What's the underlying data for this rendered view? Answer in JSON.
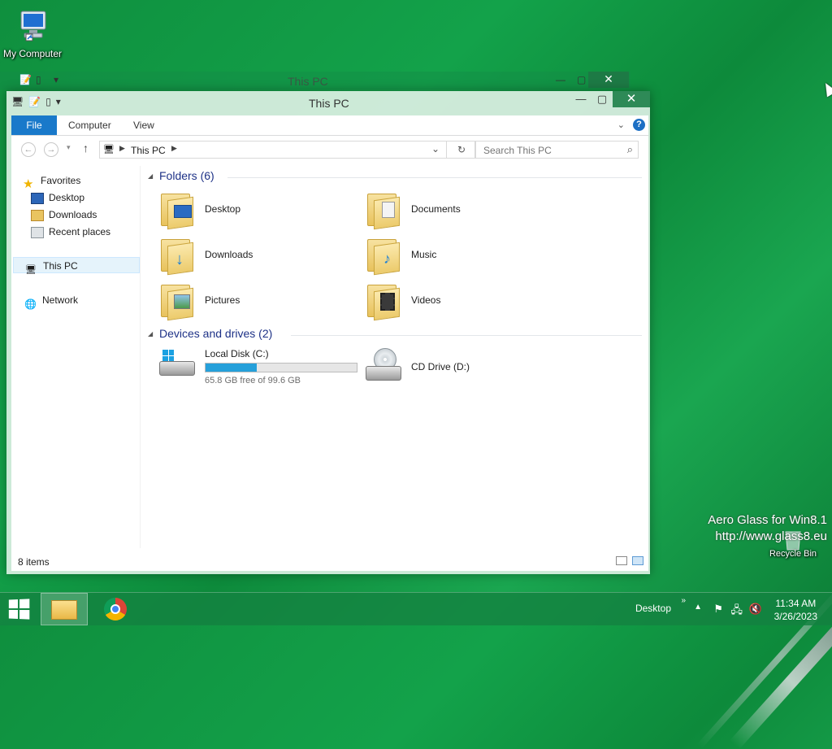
{
  "desktop": {
    "icons": [
      {
        "label": "My Computer",
        "icon": "computer-icon"
      },
      {
        "label": "Recycle Bin",
        "icon": "recycle-bin-icon"
      }
    ],
    "watermark": {
      "line1": "Aero Glass for Win8.1",
      "line2": "http://www.glass8.eu"
    }
  },
  "ghost_window": {
    "title": "This PC"
  },
  "window": {
    "title": "This PC",
    "ribbon": {
      "file": "File",
      "computer": "Computer",
      "view": "View",
      "help": "?"
    },
    "address": {
      "crumb": "This PC"
    },
    "search": {
      "placeholder": "Search This PC"
    },
    "nav": {
      "favorites": "Favorites",
      "desktop": "Desktop",
      "downloads": "Downloads",
      "recent": "Recent places",
      "this_pc": "This PC",
      "network": "Network"
    },
    "folders_header": "Folders (6)",
    "folders": [
      {
        "label": "Desktop",
        "icon": "desktop-folder-icon"
      },
      {
        "label": "Documents",
        "icon": "documents-folder-icon"
      },
      {
        "label": "Downloads",
        "icon": "downloads-folder-icon"
      },
      {
        "label": "Music",
        "icon": "music-folder-icon"
      },
      {
        "label": "Pictures",
        "icon": "pictures-folder-icon"
      },
      {
        "label": "Videos",
        "icon": "videos-folder-icon"
      }
    ],
    "drives_header": "Devices and drives (2)",
    "drives": {
      "c": {
        "label": "Local Disk (C:)",
        "free": "65.8 GB free of 99.6 GB",
        "used_fraction": 0.34
      },
      "d": {
        "label": "CD Drive (D:)"
      }
    },
    "status": {
      "count": "8 items"
    }
  },
  "taskbar": {
    "desktop_label": "Desktop",
    "time": "11:34 AM",
    "date": "3/26/2023"
  },
  "colors": {
    "accent": "#1979ca",
    "group_header": "#1e3287",
    "drive_bar": "#26a0da"
  }
}
